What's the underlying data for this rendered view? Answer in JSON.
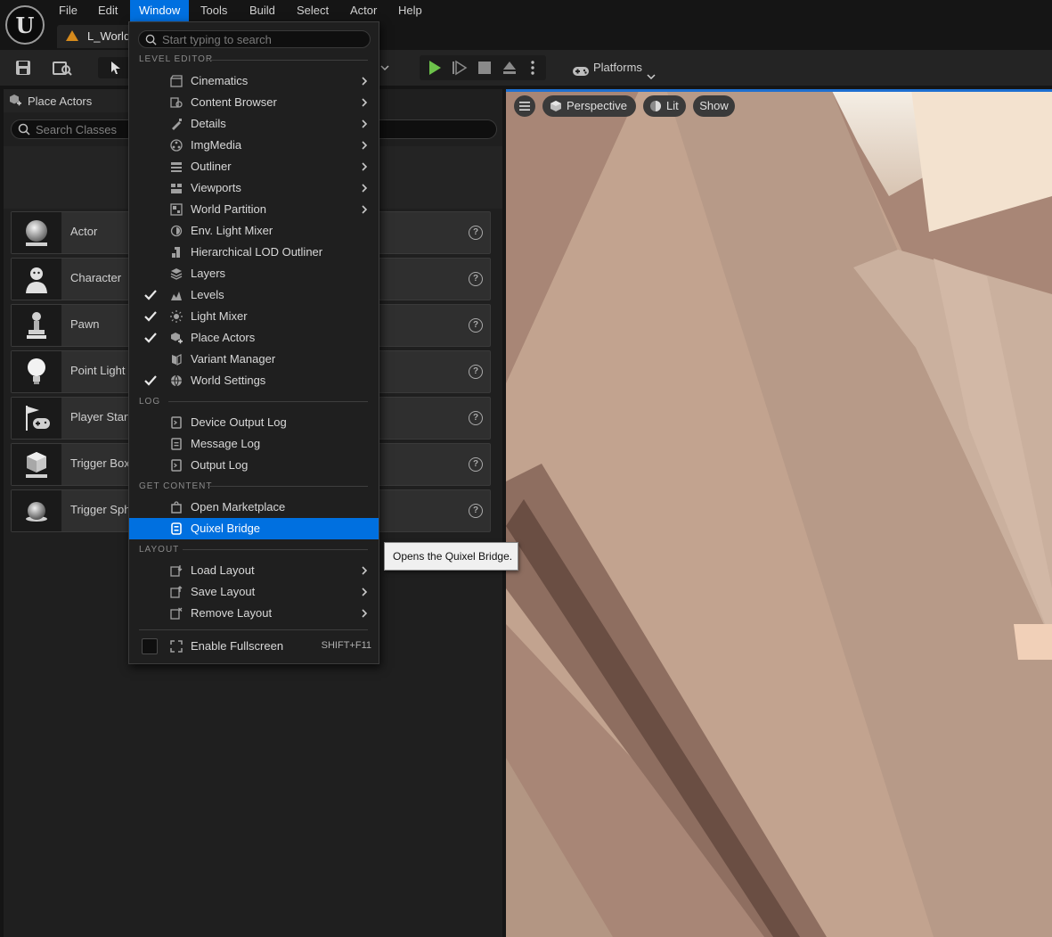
{
  "app": {
    "logo_glyph": "U",
    "level_tab": "L_World"
  },
  "menubar": {
    "items": [
      "File",
      "Edit",
      "Window",
      "Tools",
      "Build",
      "Select",
      "Actor",
      "Help"
    ],
    "active": "Window"
  },
  "toolbar": {
    "platforms_label": "Platforms"
  },
  "place_actors": {
    "tab_label": "Place Actors",
    "search_placeholder": "Search Classes",
    "items": [
      "Actor",
      "Character",
      "Pawn",
      "Point Light",
      "Player Start",
      "Trigger Box",
      "Trigger Sphere"
    ]
  },
  "viewport": {
    "perspective_label": "Perspective",
    "lit_label": "Lit",
    "show_label": "Show"
  },
  "window_menu": {
    "search_placeholder": "Start typing to search",
    "sections": {
      "level_editor": "LEVEL EDITOR",
      "log": "LOG",
      "get_content": "GET CONTENT",
      "layout": "LAYOUT"
    },
    "level_editor_items": [
      {
        "label": "Cinematics",
        "submenu": true,
        "checked": false
      },
      {
        "label": "Content Browser",
        "submenu": true,
        "checked": false
      },
      {
        "label": "Details",
        "submenu": true,
        "checked": false
      },
      {
        "label": "ImgMedia",
        "submenu": true,
        "checked": false
      },
      {
        "label": "Outliner",
        "submenu": true,
        "checked": false
      },
      {
        "label": "Viewports",
        "submenu": true,
        "checked": false
      },
      {
        "label": "World Partition",
        "submenu": true,
        "checked": false
      },
      {
        "label": "Env. Light Mixer",
        "submenu": false,
        "checked": false
      },
      {
        "label": "Hierarchical LOD Outliner",
        "submenu": false,
        "checked": false
      },
      {
        "label": "Layers",
        "submenu": false,
        "checked": false
      },
      {
        "label": "Levels",
        "submenu": false,
        "checked": true
      },
      {
        "label": "Light Mixer",
        "submenu": false,
        "checked": true
      },
      {
        "label": "Place Actors",
        "submenu": false,
        "checked": true
      },
      {
        "label": "Variant Manager",
        "submenu": false,
        "checked": false
      },
      {
        "label": "World Settings",
        "submenu": false,
        "checked": true
      }
    ],
    "log_items": [
      "Device Output Log",
      "Message Log",
      "Output Log"
    ],
    "content_items": [
      "Open Marketplace",
      "Quixel Bridge"
    ],
    "highlighted": "Quixel Bridge",
    "layout_items": [
      "Load Layout",
      "Save Layout",
      "Remove Layout"
    ],
    "fullscreen": {
      "label": "Enable Fullscreen",
      "shortcut": "SHIFT+F11"
    }
  },
  "tooltip": "Opens the Quixel Bridge.",
  "colors": {
    "accent": "#0070e0",
    "check": "#e8e8e8",
    "play_green": "#6cc24a",
    "warning": "#d68a1c"
  }
}
